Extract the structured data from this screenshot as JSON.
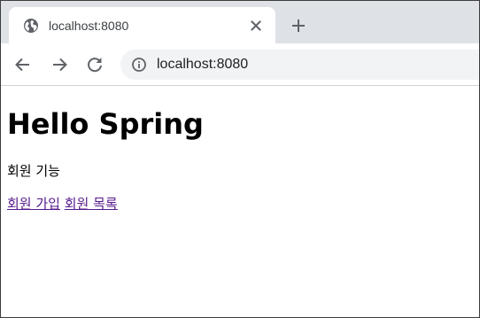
{
  "browser": {
    "tab": {
      "title": "localhost:8080"
    },
    "address_bar": {
      "url": "localhost:8080"
    }
  },
  "page": {
    "heading": "Hello Spring",
    "section_label": "회원 기능",
    "links": [
      {
        "label": "회원 가입"
      },
      {
        "label": "회원 목록"
      }
    ]
  },
  "colors": {
    "tabstrip_bg": "#dee1e6",
    "visited_link": "#551a8b",
    "omnibox_bg": "#f1f3f4"
  }
}
